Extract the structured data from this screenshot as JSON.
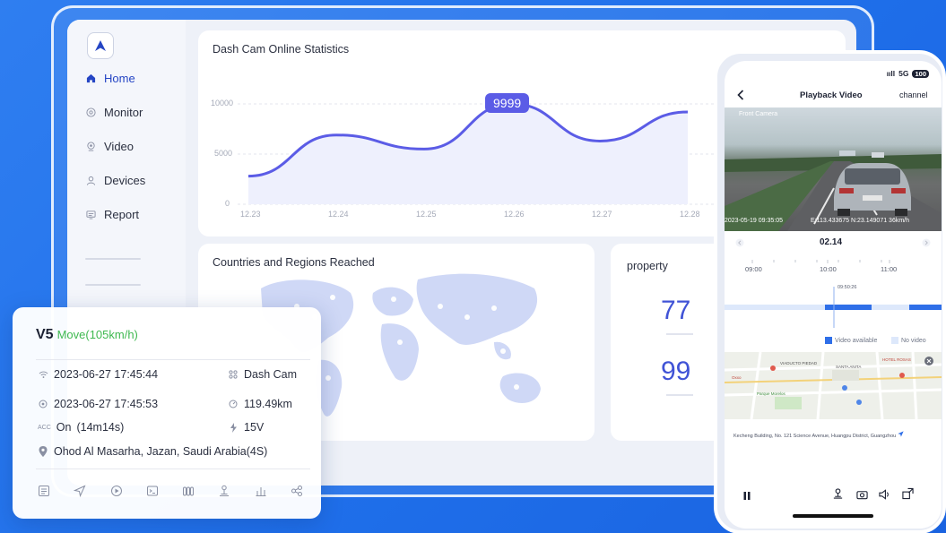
{
  "sidebar": {
    "items": [
      {
        "label": "Home",
        "icon": "home-icon",
        "active": true
      },
      {
        "label": "Monitor",
        "icon": "monitor-icon",
        "active": false
      },
      {
        "label": "Video",
        "icon": "video-icon",
        "active": false
      },
      {
        "label": "Devices",
        "icon": "devices-icon",
        "active": false
      },
      {
        "label": "Report",
        "icon": "report-icon",
        "active": false
      }
    ]
  },
  "online_stats": {
    "title": "Dash Cam Online Statistics",
    "tooltip": "9999"
  },
  "chart_data": {
    "type": "line",
    "title": "Dash Cam Online Statistics",
    "x": [
      "12.23",
      "12.24",
      "12.25",
      "12.26",
      "12.27",
      "12.28"
    ],
    "ylim": [
      0,
      10000
    ],
    "yticks": [
      "10000",
      "5000",
      "0"
    ],
    "series": [
      {
        "values": [
          2800,
          6900,
          5500,
          9999,
          6300,
          9200
        ]
      }
    ],
    "grid": true,
    "highlight": {
      "x": "12.26",
      "label": "9999"
    },
    "color": "#5b5ce6"
  },
  "countries": {
    "title": "Countries and Regions Reached"
  },
  "property": {
    "title": "property",
    "values": [
      "77",
      "99"
    ]
  },
  "vehicle": {
    "name": "V5",
    "status": "Move(105km/h)",
    "signal_time": "2023-06-27 17:45:44",
    "device_type": "Dash Cam",
    "gps_time": "2023-06-27 17:45:53",
    "mileage": "119.49km",
    "acc_label": "ACC",
    "acc_value": "On",
    "acc_duration": "(14m14s)",
    "voltage": "15V",
    "location": "Ohod Al Masarha, Jazan, Saudi Arabia(4S)",
    "status_color": "#3fb950",
    "tools": [
      "detail-icon",
      "navigate-icon",
      "play-icon",
      "terminal-icon",
      "cylinders-icon",
      "geofence-icon",
      "bar-chart-icon",
      "share-icon"
    ]
  },
  "phone": {
    "status_bar": {
      "signal": "ııll",
      "network": "5G",
      "battery": "100"
    },
    "title": "Playback Video",
    "channel": "channel",
    "camera_label": "Front Camera",
    "timestamp": "2023-05-19 09:35:05",
    "coords": "E:113.433675  N:23.149071  36km/h",
    "date": "02.14",
    "timeline": [
      "09:00",
      "10:00",
      "11:00"
    ],
    "cursor_time": "09:50:26",
    "legend": {
      "available": "Video available",
      "none": "No video"
    },
    "address": "Kecheng Building, No. 121 Science Avenue, Huangpu District, Guangzhou",
    "map_labels": [
      "VIADUCTO PIEDAD",
      "SANTA ANITA",
      "Oxxo",
      "Parque Morelos",
      "HOTEL ROSAS"
    ]
  }
}
